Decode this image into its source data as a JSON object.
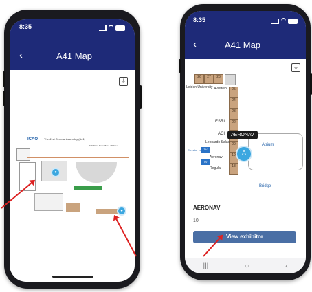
{
  "left_phone": {
    "status_time": "8:35",
    "app_title": "A41 Map",
    "back_icon": "chevron-left-icon",
    "filter_icon": "filter-icon",
    "map_header_small": "ICAO",
    "map_header_line1": "The 41st General Assembly (A41)",
    "map_header_line2": "Exhibition Floor Plan - 4th Floor"
  },
  "right_phone": {
    "status_time": "8:35",
    "app_title": "A41 Map",
    "back_icon": "chevron-left-icon",
    "filter_icon": "filter-icon",
    "map_labels": {
      "leiden": "Leiden University",
      "aviaweb": "Aviaweb",
      "esri": "ESRI",
      "aci": "ACI",
      "leonardo": "Leonardo Salas",
      "aeronav": "Aeronav",
      "regula": "Regula",
      "atrium": "Atrium",
      "bridge": "Bridge",
      "elevator": "Elevator Lane 1-5",
      "tv": "TV"
    },
    "booth_numbers": [
      "26",
      "27",
      "28",
      "25",
      "24",
      "23",
      "22",
      "21",
      "20",
      "19",
      "18"
    ],
    "tooltip": "AERONAV",
    "selected_name": "AERONAV",
    "selected_booth": "10",
    "view_button": "View exhibitor"
  },
  "colors": {
    "appbar": "#1e2a78",
    "button": "#4a6fa5",
    "pin": "#3ba7e0",
    "booth": "#c9a37e",
    "arrow": "#d22222"
  }
}
